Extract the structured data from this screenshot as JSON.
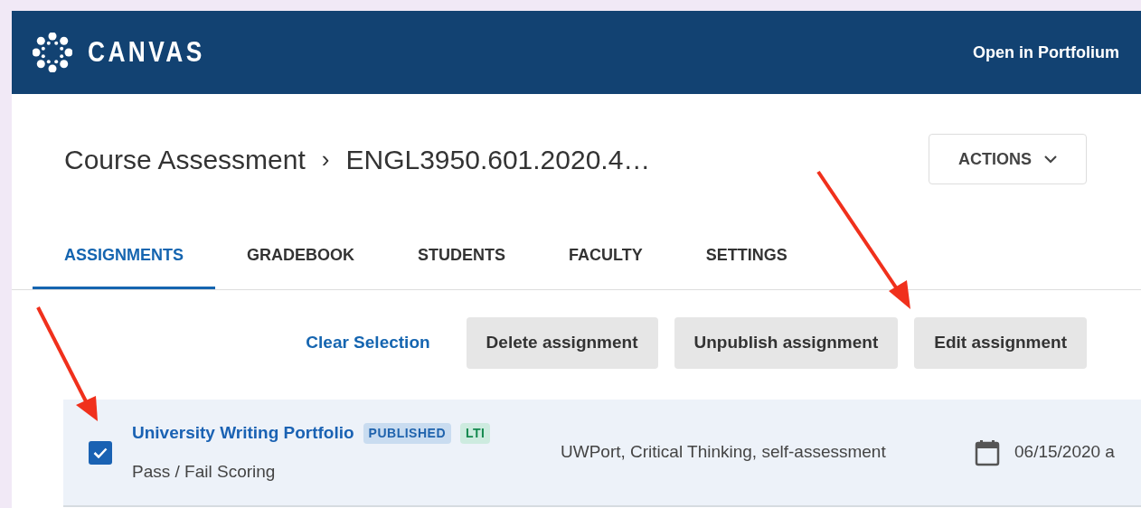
{
  "header": {
    "logo_text": "CANVAS",
    "link": "Open in Portfolium"
  },
  "breadcrumb": [
    "Course Assessment",
    "›",
    "ENGL3950.601.2020.4…"
  ],
  "actions_button": "ACTIONS",
  "tabs": [
    {
      "label": "ASSIGNMENTS",
      "selected": true
    },
    {
      "label": "GRADEBOOK",
      "selected": false
    },
    {
      "label": "STUDENTS",
      "selected": false
    },
    {
      "label": "FACULTY",
      "selected": false
    },
    {
      "label": "SETTINGS",
      "selected": false
    }
  ],
  "toolbar": {
    "clear_link": "Clear Selection",
    "buttons": [
      "Delete assignment",
      "Unpublish assignment",
      "Edit assignment"
    ]
  },
  "assignments": [
    {
      "checked": true,
      "title": "University Writing Portfolio",
      "badges": [
        {
          "label": "PUBLISHED",
          "kind": "status"
        },
        {
          "label": "LTI",
          "kind": "type"
        }
      ],
      "scoring": "Pass / Fail Scoring",
      "outcomes": "UWPort, Critical Thinking, self-assessment",
      "due": "06/15/2020 a"
    }
  ]
}
